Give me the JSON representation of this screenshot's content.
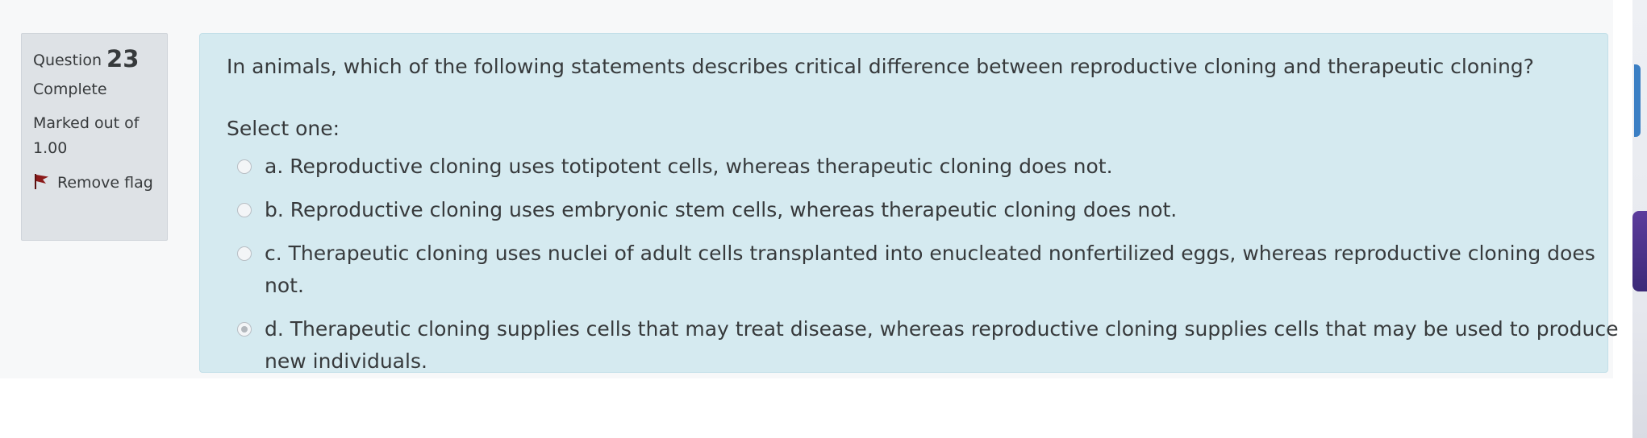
{
  "question_info": {
    "label": "Question",
    "number": "23",
    "state": "Complete",
    "grade": "Marked out of 1.00",
    "flag_label": "Remove flag",
    "flag_color": "#8b1a1a"
  },
  "question": {
    "text": "In animals, which of the following statements describes critical difference between reproductive cloning and therapeutic cloning?",
    "prompt": "Select one:",
    "answers": [
      {
        "label": "a. Reproductive cloning uses totipotent cells, whereas therapeutic cloning does not.",
        "selected": false
      },
      {
        "label": "b. Reproductive cloning uses embryonic stem cells, whereas therapeutic cloning does not.",
        "selected": false
      },
      {
        "label": "c. Therapeutic cloning uses nuclei of adult cells transplanted into enucleated nonfertilized eggs, whereas reproductive cloning does not.",
        "selected": false
      },
      {
        "label": "d. Therapeutic cloning supplies cells that may treat disease, whereas reproductive cloning supplies cells that may be used to produce new individuals.",
        "selected": true
      }
    ]
  },
  "colors": {
    "info_background": "#dee2e6",
    "formulation_background": "#d5eaf0",
    "text": "#373a3c"
  }
}
